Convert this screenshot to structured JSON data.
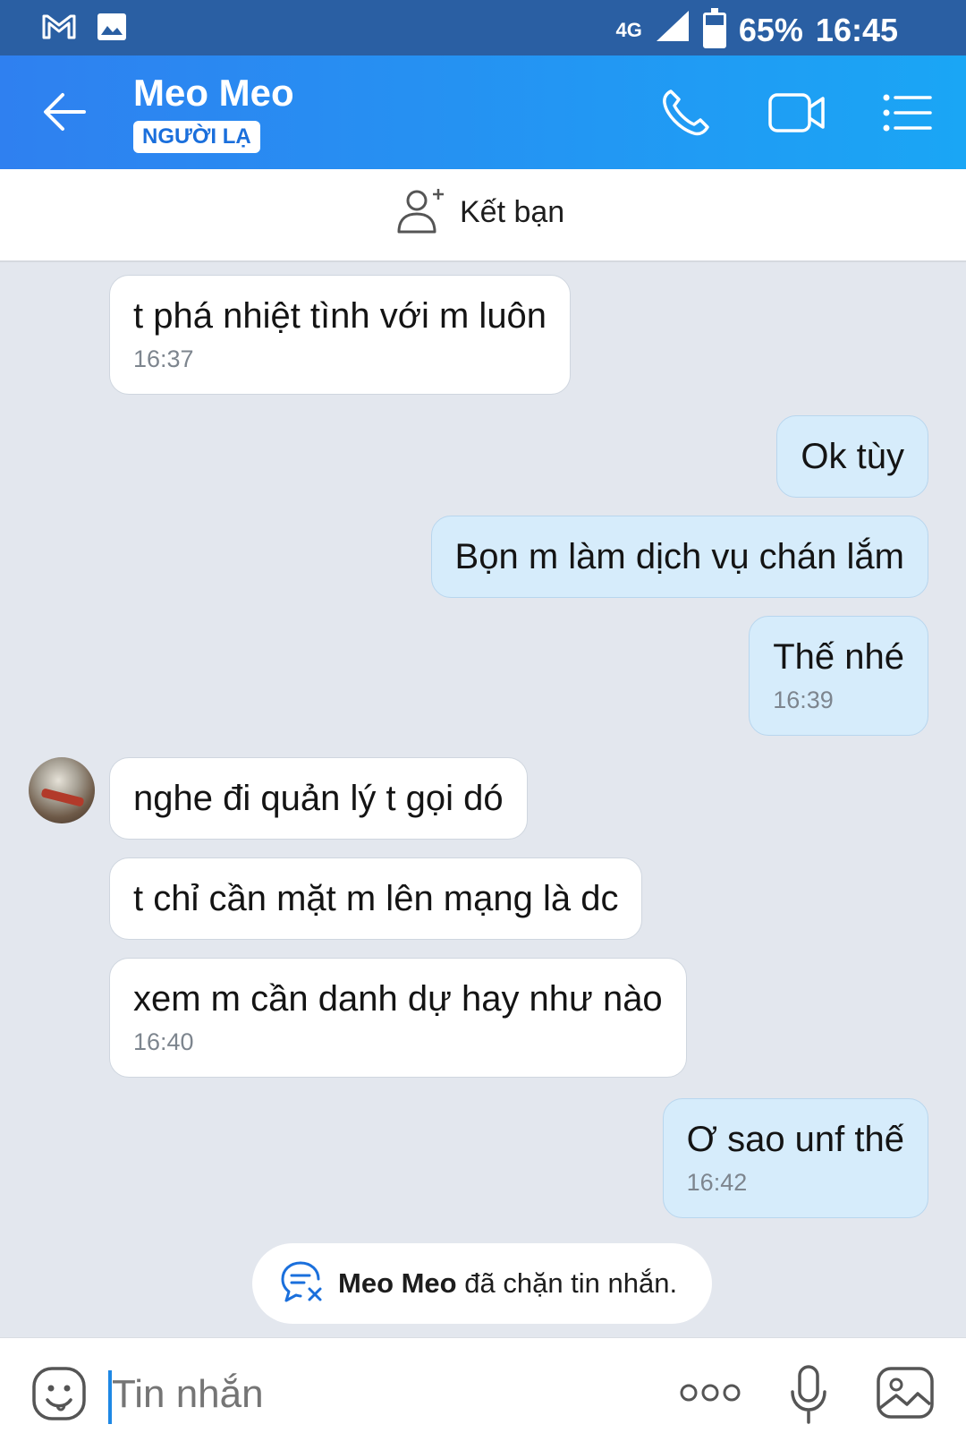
{
  "status_bar": {
    "network": "4G",
    "battery": "65%",
    "time": "16:45",
    "left_icons": [
      "gmail-icon",
      "gallery-icon"
    ]
  },
  "header": {
    "name": "Meo Meo",
    "badge": "NGƯỜI LẠ",
    "icons": [
      "back-arrow-icon",
      "phone-icon",
      "video-camera-icon",
      "menu-list-icon"
    ]
  },
  "friend_bar": {
    "label": "Kết bạn"
  },
  "messages": [
    {
      "dir": "in",
      "text": "t phá nhiệt tình với m luôn",
      "time": "16:37"
    },
    {
      "dir": "out",
      "text": "Ok tùy",
      "time": ""
    },
    {
      "dir": "out",
      "text": "Bọn m làm dịch vụ chán lắm",
      "time": ""
    },
    {
      "dir": "out",
      "text": "Thế nhé",
      "time": "16:39"
    },
    {
      "dir": "in",
      "text": "nghe đi quản lý t gọi dó",
      "time": ""
    },
    {
      "dir": "in",
      "text": "t chỉ cần mặt m lên mạng là dc",
      "time": ""
    },
    {
      "dir": "in",
      "text": "xem m cần danh dự hay  như nào",
      "time": "16:40"
    },
    {
      "dir": "out",
      "text": "Ơ sao unf thế",
      "time": "16:42"
    }
  ],
  "blocked_notice": {
    "name": "Meo Meo",
    "text": " đã chặn tin nhắn."
  },
  "input_bar": {
    "placeholder": "Tin nhắn"
  },
  "colors": {
    "header_start": "#2f80f0",
    "header_end": "#1aa6f5",
    "outgoing_bubble": "#d6ecfb",
    "incoming_bubble": "#ffffff",
    "background": "#e3e7ee"
  }
}
